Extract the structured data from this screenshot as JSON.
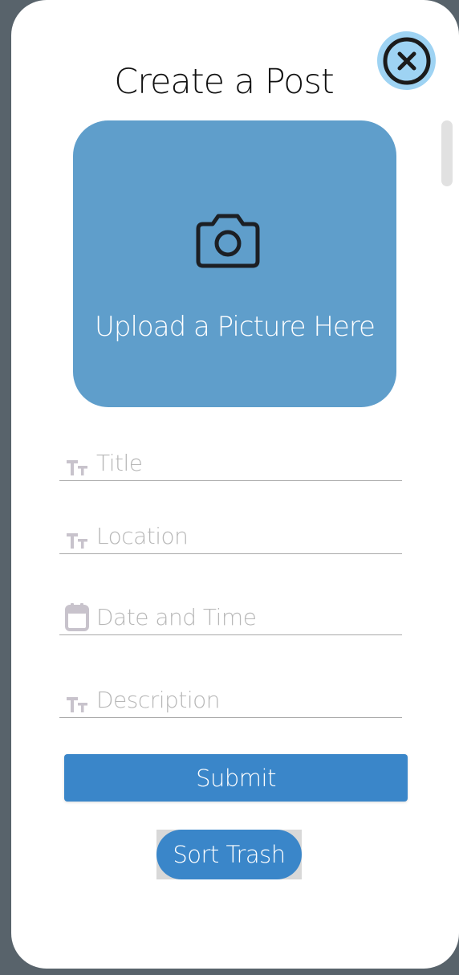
{
  "modal": {
    "title": "Create a Post"
  },
  "upload": {
    "label": "Upload a Picture Here",
    "icon": "camera-icon"
  },
  "form": {
    "fields": [
      {
        "icon": "text-size-icon",
        "placeholder": "Title"
      },
      {
        "icon": "text-size-icon",
        "placeholder": "Location"
      },
      {
        "icon": "calendar-icon",
        "placeholder": "Date and Time"
      },
      {
        "icon": "text-size-icon",
        "placeholder": "Description"
      }
    ],
    "submit_label": "Submit",
    "sort_label": "Sort Trash"
  },
  "colors": {
    "background": "#58636b",
    "modal": "#ffffff",
    "upload_box": "#5f9ecb",
    "primary_button": "#3a86c9",
    "close_halo": "#9ed3f3",
    "placeholder": "#b7b7b7",
    "field_icon": "#c8c3cc"
  }
}
